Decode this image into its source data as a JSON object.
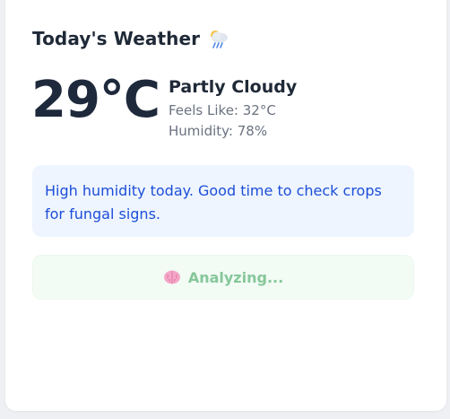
{
  "weather": {
    "title": "Today's Weather",
    "title_icon": "cloud-rain-icon",
    "temperature": "29°C",
    "condition": "Partly Cloudy",
    "feels_like": "Feels Like: 32°C",
    "humidity": "Humidity: 78%"
  },
  "advice": {
    "text": "High humidity today. Good time to check crops for fungal signs."
  },
  "analyze_button": {
    "icon": "brain-icon",
    "label": "Analyzing..."
  },
  "colors": {
    "advice_bg": "#eef5ff",
    "advice_text": "#1d4ed8",
    "button_bg": "#f2fbf4",
    "button_text": "#86c79a"
  }
}
